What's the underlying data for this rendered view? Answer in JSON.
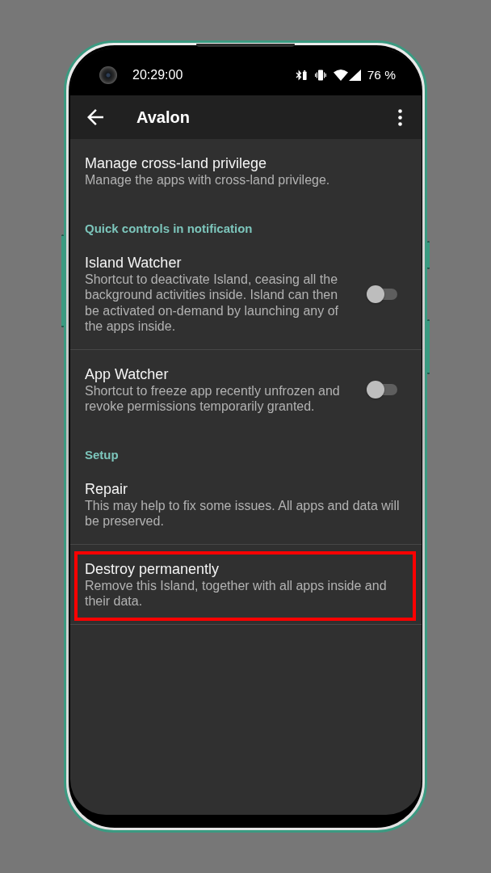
{
  "status_bar": {
    "time": "20:29:00",
    "battery": "76 %"
  },
  "app_bar": {
    "title": "Avalon"
  },
  "sections": [
    {
      "items": [
        {
          "kind": "plain",
          "title": "Manage cross-land privilege",
          "summary": "Manage the apps with cross-land privilege.",
          "highlighted": false
        }
      ]
    },
    {
      "header": "Quick controls in notification",
      "items": [
        {
          "kind": "switch",
          "title": "Island Watcher",
          "summary": "Shortcut to deactivate Island, ceasing all the background activities inside. Island can then be activated on-demand by launching any of the apps inside.",
          "on": false,
          "highlighted": false
        },
        {
          "kind": "switch",
          "title": "App Watcher",
          "summary": "Shortcut to freeze app recently unfrozen and revoke permissions temporarily granted.",
          "on": false,
          "highlighted": false
        }
      ]
    },
    {
      "header": "Setup",
      "items": [
        {
          "kind": "plain",
          "title": "Repair",
          "summary": "This may help to fix some issues. All apps and data will be preserved.",
          "highlighted": false
        },
        {
          "kind": "plain",
          "title": "Destroy permanently",
          "summary": "Remove this Island, together with all apps inside and their data.",
          "highlighted": true
        }
      ]
    }
  ]
}
